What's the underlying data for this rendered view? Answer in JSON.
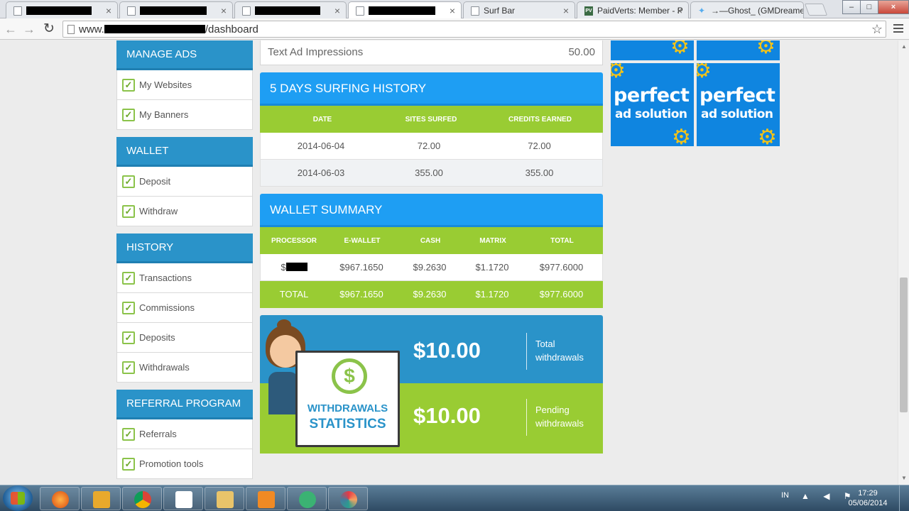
{
  "browser": {
    "tabs": [
      {
        "label": "",
        "redacted": true,
        "active": false
      },
      {
        "label": "",
        "redacted": true,
        "active": false
      },
      {
        "label": "",
        "redacted": true,
        "active": false
      },
      {
        "label": "",
        "redacted": true,
        "active": true
      },
      {
        "label": "Surf Bar",
        "redacted": false,
        "active": false
      },
      {
        "label": "PaidVerts: Member - P",
        "redacted": false,
        "active": false
      },
      {
        "label": "→—Ghost_ (GMDreame",
        "redacted": false,
        "active": false
      }
    ],
    "favicon_pv": "PV",
    "close_glyph": "×",
    "url_prefix": "www.",
    "url_suffix": "/dashboard",
    "window_buttons": {
      "minimize": "–",
      "maximize": "□",
      "close": "×"
    }
  },
  "sidebar": {
    "sections": [
      {
        "title": "MANAGE ADS",
        "items": [
          "My Websites",
          "My Banners"
        ]
      },
      {
        "title": "WALLET",
        "items": [
          "Deposit",
          "Withdraw"
        ]
      },
      {
        "title": "HISTORY",
        "items": [
          "Transactions",
          "Commissions",
          "Deposits",
          "Withdrawals"
        ]
      },
      {
        "title": "REFERRAL PROGRAM",
        "items": [
          "Referrals",
          "Promotion tools"
        ]
      }
    ],
    "check_glyph": "✓"
  },
  "impressions": {
    "label": "Text Ad Impressions",
    "value": "50.00"
  },
  "surfing_history": {
    "title": "5 DAYS SURFING HISTORY",
    "columns": [
      "DATE",
      "SITES SURFED",
      "CREDITS EARNED"
    ],
    "rows": [
      [
        "2014-06-04",
        "72.00",
        "72.00"
      ],
      [
        "2014-06-03",
        "355.00",
        "355.00"
      ]
    ]
  },
  "wallet_summary": {
    "title": "WALLET SUMMARY",
    "columns": [
      "PROCESSOR",
      "E-WALLET",
      "CASH",
      "MATRIX",
      "TOTAL"
    ],
    "row": {
      "processor_prefix": "$",
      "ewallet": "$967.1650",
      "cash": "$9.2630",
      "matrix": "$1.1720",
      "total": "$977.6000"
    },
    "total_row": {
      "label": "TOTAL",
      "ewallet": "$967.1650",
      "cash": "$9.2630",
      "matrix": "$1.1720",
      "total": "$977.6000"
    }
  },
  "withdrawals": {
    "board_line1": "WITHDRAWALS",
    "board_line2": "STATISTICS",
    "coin": "$",
    "total_amount": "$10.00",
    "total_label": "Total withdrawals",
    "pending_amount": "$10.00",
    "pending_label": "Pending withdrawals"
  },
  "ads": {
    "line1": "perfect",
    "line2": "ad solution",
    "gear_glyph": "⚙"
  },
  "taskbar": {
    "lang": "IN",
    "tray_icons": "▲ ◀ ⚑",
    "time": "17:29",
    "date": "05/06/2014"
  },
  "colors": {
    "blue_header": "#2a93c9",
    "bright_blue": "#1e9ef3",
    "green": "#99cc33",
    "ad_blue": "#0f85e0",
    "gear_yellow": "#f2c319"
  }
}
